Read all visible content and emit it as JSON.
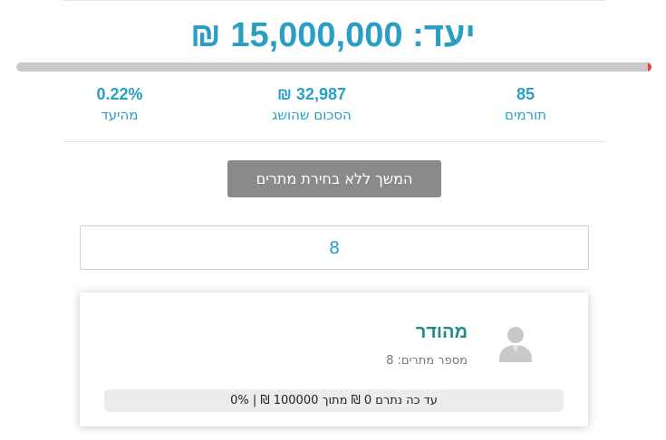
{
  "goal": {
    "title": "יעד: 15,000,000 ₪",
    "progress_percent": 0.22
  },
  "stats": {
    "donors": {
      "value": "85",
      "label": "תורמים"
    },
    "raised": {
      "value": "32,987 ₪",
      "label": "הסכום שהושג"
    },
    "percent": {
      "value": "0.22%",
      "label": "מהיעד"
    }
  },
  "continue_button": {
    "label": "המשך ללא בחירת מתרים"
  },
  "search": {
    "value": "8"
  },
  "fundraiser_card": {
    "name": "מהודר",
    "count_label": "מספר מתרים:",
    "count_value": "8",
    "avatar_icon": "user-silhouette-icon",
    "progress_text": "עד כה נתרם 0 ₪ מתוך 100000 ₪ | 0%",
    "progress_percent": 0
  },
  "colors": {
    "accent": "#2a9fc3",
    "progress_track": "#c9c9c9",
    "progress_fill": "#e8443f",
    "name": "#1e8a8a",
    "button_bg": "#8a8a8a"
  }
}
